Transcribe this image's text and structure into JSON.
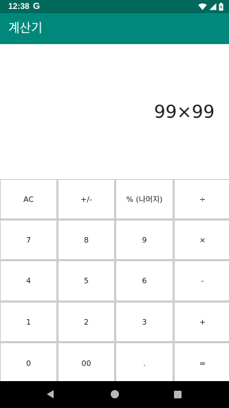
{
  "status_bar": {
    "time": "12:38",
    "google_icon_letter": "G",
    "icons": [
      "wifi-icon",
      "signal-icon",
      "battery-icon"
    ]
  },
  "app_bar": {
    "title": "계산기",
    "color": "#00897b"
  },
  "display": {
    "expression": "99×99"
  },
  "keypad": {
    "rows": [
      [
        "AC",
        "+/-",
        "% (나머지)",
        "÷"
      ],
      [
        "7",
        "8",
        "9",
        "×"
      ],
      [
        "4",
        "5",
        "6",
        "-"
      ],
      [
        "1",
        "2",
        "3",
        "+"
      ],
      [
        "0",
        "00",
        ".",
        "="
      ]
    ]
  },
  "nav_bar": {
    "icons": [
      "back-icon",
      "home-icon",
      "recents-icon"
    ]
  },
  "colors": {
    "status_bar": "#00695c",
    "app_bar": "#00897b",
    "nav_bar": "#000000"
  }
}
